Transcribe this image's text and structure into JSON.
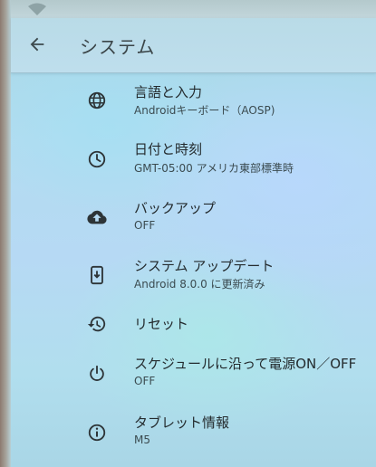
{
  "appbar": {
    "title": "システム"
  },
  "items": [
    {
      "label": "言語と入力",
      "sub": "Androidキーボード（AOSP)",
      "icon": "globe-icon"
    },
    {
      "label": "日付と時刻",
      "sub": "GMT-05:00 アメリカ東部標準時",
      "icon": "clock-icon"
    },
    {
      "label": "バックアップ",
      "sub": "OFF",
      "icon": "cloud-upload-icon"
    },
    {
      "label": "システム アップデート",
      "sub": "Android 8.0.0 に更新済み",
      "icon": "system-update-icon"
    },
    {
      "label": "リセット",
      "sub": "",
      "icon": "restore-icon"
    },
    {
      "label": "スケジュールに沿って電源ON／OFF",
      "sub": "OFF",
      "icon": "power-schedule-icon"
    },
    {
      "label": "タブレット情報",
      "sub": "M5",
      "icon": "info-icon"
    }
  ]
}
